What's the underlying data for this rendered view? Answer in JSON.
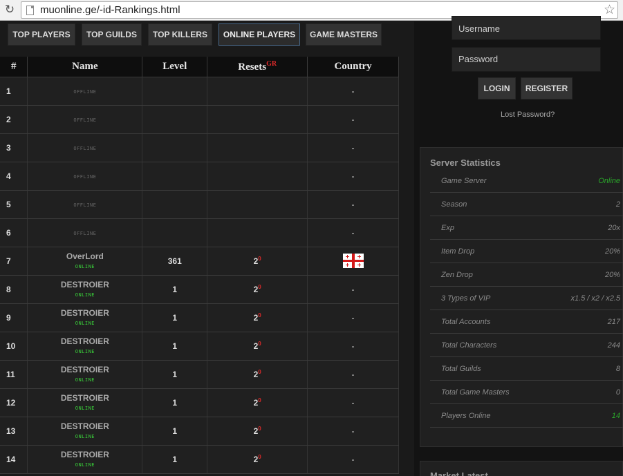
{
  "browser": {
    "url": "muonline.ge/-id-Rankings.html",
    "reload_icon": "↻",
    "star_icon": "☆"
  },
  "tabs": [
    {
      "label": "TOP PLAYERS"
    },
    {
      "label": "TOP GUILDS"
    },
    {
      "label": "TOP KILLERS"
    },
    {
      "label": "ONLINE PLAYERS",
      "active": true
    },
    {
      "label": "GAME MASTERS"
    }
  ],
  "table": {
    "headers": {
      "num": "#",
      "name": "Name",
      "level": "Level",
      "resets": "Resets",
      "resets_sup": "GR",
      "country": "Country"
    },
    "rows": [
      {
        "num": "1",
        "name": "",
        "status": "OFFLINE",
        "level": "",
        "resets": "",
        "resets_sup": "",
        "country": "-"
      },
      {
        "num": "2",
        "name": "",
        "status": "OFFLINE",
        "level": "",
        "resets": "",
        "resets_sup": "",
        "country": "-"
      },
      {
        "num": "3",
        "name": "",
        "status": "OFFLINE",
        "level": "",
        "resets": "",
        "resets_sup": "",
        "country": "-"
      },
      {
        "num": "4",
        "name": "",
        "status": "OFFLINE",
        "level": "",
        "resets": "",
        "resets_sup": "",
        "country": "-"
      },
      {
        "num": "5",
        "name": "",
        "status": "OFFLINE",
        "level": "",
        "resets": "",
        "resets_sup": "",
        "country": "-"
      },
      {
        "num": "6",
        "name": "",
        "status": "OFFLINE",
        "level": "",
        "resets": "",
        "resets_sup": "",
        "country": "-"
      },
      {
        "num": "7",
        "name": "OverLord",
        "status": "ONLINE",
        "level": "361",
        "resets": "2",
        "resets_sup": "0",
        "country": "",
        "flag": "georgia-flag-icon"
      },
      {
        "num": "8",
        "name": "DESTROIER",
        "status": "ONLINE",
        "level": "1",
        "resets": "2",
        "resets_sup": "0",
        "country": "-"
      },
      {
        "num": "9",
        "name": "DESTROIER",
        "status": "ONLINE",
        "level": "1",
        "resets": "2",
        "resets_sup": "0",
        "country": "-"
      },
      {
        "num": "10",
        "name": "DESTROIER",
        "status": "ONLINE",
        "level": "1",
        "resets": "2",
        "resets_sup": "0",
        "country": "-"
      },
      {
        "num": "11",
        "name": "DESTROIER",
        "status": "ONLINE",
        "level": "1",
        "resets": "2",
        "resets_sup": "0",
        "country": "-"
      },
      {
        "num": "12",
        "name": "DESTROIER",
        "status": "ONLINE",
        "level": "1",
        "resets": "2",
        "resets_sup": "0",
        "country": "-"
      },
      {
        "num": "13",
        "name": "DESTROIER",
        "status": "ONLINE",
        "level": "1",
        "resets": "2",
        "resets_sup": "0",
        "country": "-"
      },
      {
        "num": "14",
        "name": "DESTROIER",
        "status": "ONLINE",
        "level": "1",
        "resets": "2",
        "resets_sup": "0",
        "country": "-"
      }
    ]
  },
  "login": {
    "username_placeholder": "Username",
    "password_placeholder": "Password",
    "login_label": "LOGIN",
    "register_label": "REGISTER",
    "lost_password": "Lost Password?"
  },
  "stats": {
    "title": "Server Statistics",
    "rows": [
      {
        "label": "Game Server",
        "value": "Online",
        "green": true
      },
      {
        "label": "Season",
        "value": "2"
      },
      {
        "label": "Exp",
        "value": "20x"
      },
      {
        "label": "Item Drop",
        "value": "20%"
      },
      {
        "label": "Zen Drop",
        "value": "20%"
      },
      {
        "label": "3 Types of VIP",
        "value": "x1.5 / x2 / x2.5"
      },
      {
        "label": "Total Accounts",
        "value": "217"
      },
      {
        "label": "Total Characters",
        "value": "244"
      },
      {
        "label": "Total Guilds",
        "value": "8"
      },
      {
        "label": "Total Game Masters",
        "value": "0"
      },
      {
        "label": "Players Online",
        "value": "14",
        "green": true
      }
    ]
  },
  "market": {
    "title": "Market Latest"
  },
  "colors": {
    "online": "#3ad23a",
    "offline": "#666666",
    "resets_superscript": "#e02a2a",
    "background": "#1a1a1a"
  }
}
